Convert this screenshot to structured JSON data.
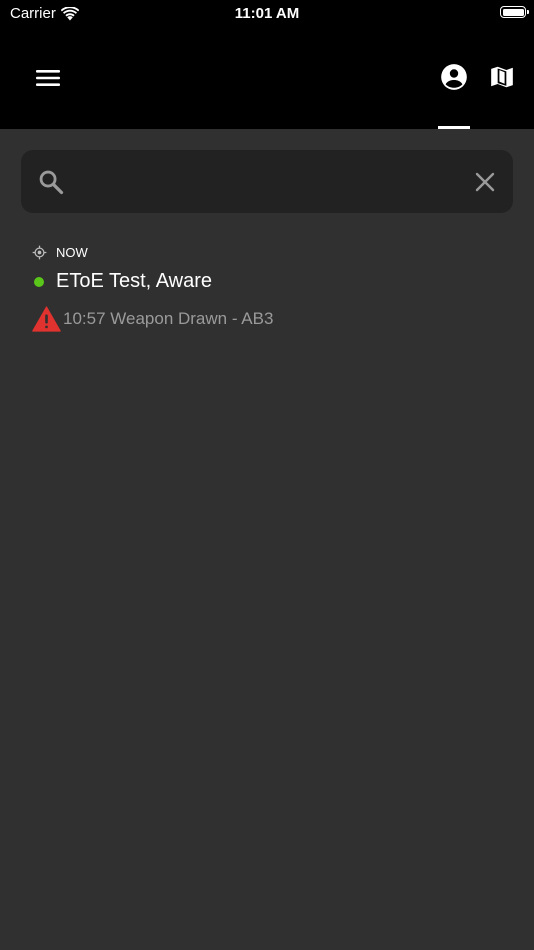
{
  "status_bar": {
    "carrier": "Carrier",
    "time": "11:01 AM"
  },
  "nav_bar": {
    "menu_icon": "menu-icon",
    "person_icon": "account-circle-icon",
    "map_icon": "map-icon"
  },
  "search": {
    "value": "",
    "placeholder": ""
  },
  "list": {
    "location_label": "NOW",
    "unit": {
      "name": "EToE Test, Aware",
      "status_color": "#5ac619"
    },
    "alert": {
      "text": "10:57 Weapon Drawn - AB3",
      "icon": "warning-icon",
      "color": "#e0332f"
    }
  },
  "colors": {
    "background": "#303030",
    "header": "#000000",
    "search_box": "#222222",
    "muted_text": "#9a9a9a"
  }
}
